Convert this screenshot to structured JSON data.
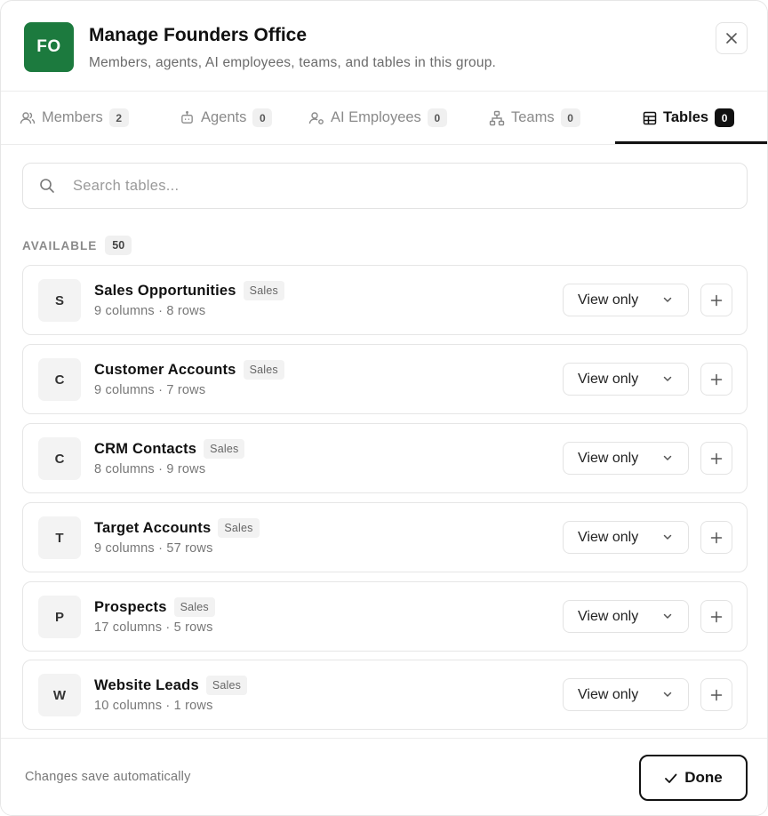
{
  "header": {
    "avatar_text": "FO",
    "avatar_color": "#1c7a3e",
    "title": "Manage Founders Office",
    "subtitle": "Members, agents, AI employees, teams, and tables in this group."
  },
  "tabs": [
    {
      "label": "Members",
      "count": "2",
      "icon": "users-icon"
    },
    {
      "label": "Agents",
      "count": "0",
      "icon": "bot-icon"
    },
    {
      "label": "AI Employees",
      "count": "0",
      "icon": "ai-employee-icon"
    },
    {
      "label": "Teams",
      "count": "0",
      "icon": "hierarchy-icon"
    },
    {
      "label": "Tables",
      "count": "0",
      "icon": "table-icon",
      "active": true
    }
  ],
  "search": {
    "placeholder": "Search tables..."
  },
  "available": {
    "label": "AVAILABLE",
    "count": "50"
  },
  "tables": [
    {
      "letter": "S",
      "name": "Sales Opportunities",
      "tag": "Sales",
      "meta": "9 columns · 8 rows",
      "permission": "View only"
    },
    {
      "letter": "C",
      "name": "Customer Accounts",
      "tag": "Sales",
      "meta": "9 columns · 7 rows",
      "permission": "View only"
    },
    {
      "letter": "C",
      "name": "CRM Contacts",
      "tag": "Sales",
      "meta": "8 columns · 9 rows",
      "permission": "View only"
    },
    {
      "letter": "T",
      "name": "Target Accounts",
      "tag": "Sales",
      "meta": "9 columns · 57 rows",
      "permission": "View only"
    },
    {
      "letter": "P",
      "name": "Prospects",
      "tag": "Sales",
      "meta": "17 columns · 5 rows",
      "permission": "View only"
    },
    {
      "letter": "W",
      "name": "Website Leads",
      "tag": "Sales",
      "meta": "10 columns · 1 rows",
      "permission": "View only"
    }
  ],
  "footer": {
    "note": "Changes save automatically",
    "done_label": "Done"
  }
}
